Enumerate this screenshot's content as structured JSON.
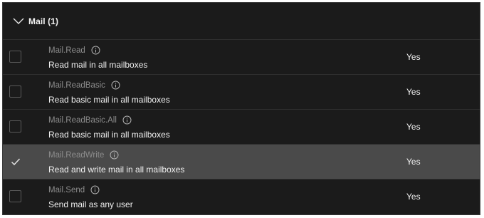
{
  "group": {
    "title": "Mail (1)",
    "expanded": true,
    "icon": "chevron-down-icon"
  },
  "permissions": [
    {
      "name": "Mail.Read",
      "description": "Read mail in all mailboxes",
      "admin_consent": "Yes",
      "checked": false
    },
    {
      "name": "Mail.ReadBasic",
      "description": "Read basic mail in all mailboxes",
      "admin_consent": "Yes",
      "checked": false
    },
    {
      "name": "Mail.ReadBasic.All",
      "description": "Read basic mail in all mailboxes",
      "admin_consent": "Yes",
      "checked": false
    },
    {
      "name": "Mail.ReadWrite",
      "description": "Read and write mail in all mailboxes",
      "admin_consent": "Yes",
      "checked": true
    },
    {
      "name": "Mail.Send",
      "description": "Send mail as any user",
      "admin_consent": "Yes",
      "checked": false
    }
  ],
  "colors": {
    "background": "#1b1b1b",
    "selected_row": "#4a4a4a",
    "text_primary": "#f0f0f0",
    "text_secondary": "#8c8c8c"
  }
}
